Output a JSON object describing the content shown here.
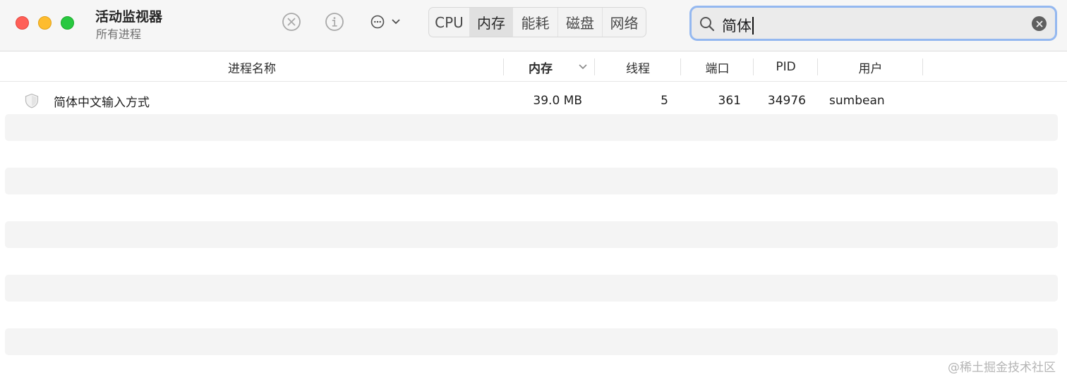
{
  "window": {
    "title": "活动监视器",
    "subtitle": "所有进程",
    "controls": [
      "close",
      "minimize",
      "zoom"
    ]
  },
  "toolbar": {
    "icons": {
      "stop": "stop-process-icon",
      "info": "info-icon",
      "more": "more-options-icon"
    },
    "tabs": [
      {
        "label": "CPU",
        "active": false
      },
      {
        "label": "内存",
        "active": true
      },
      {
        "label": "能耗",
        "active": false
      },
      {
        "label": "磁盘",
        "active": false
      },
      {
        "label": "网络",
        "active": false
      }
    ]
  },
  "search": {
    "value": "简体",
    "icon": "search-icon",
    "clear_icon": "clear-icon"
  },
  "table": {
    "columns": [
      {
        "label": "进程名称",
        "sorted": false
      },
      {
        "label": "内存",
        "sorted": true,
        "sort_direction": "descending"
      },
      {
        "label": "线程",
        "sorted": false
      },
      {
        "label": "端口",
        "sorted": false
      },
      {
        "label": "PID",
        "sorted": false
      },
      {
        "label": "用户",
        "sorted": false
      }
    ],
    "rows": [
      {
        "icon": "shield-icon",
        "name": "简体中文输入方式",
        "memory": "39.0 MB",
        "threads": "5",
        "ports": "361",
        "pid": "34976",
        "user": "sumbean"
      }
    ]
  },
  "watermark": "@稀土掘金技术社区",
  "colors": {
    "accent_focus": "#94b8f0",
    "close": "#ff5f57",
    "minimize": "#febc2e",
    "zoom": "#28c840",
    "stripe": "#f4f4f4"
  }
}
